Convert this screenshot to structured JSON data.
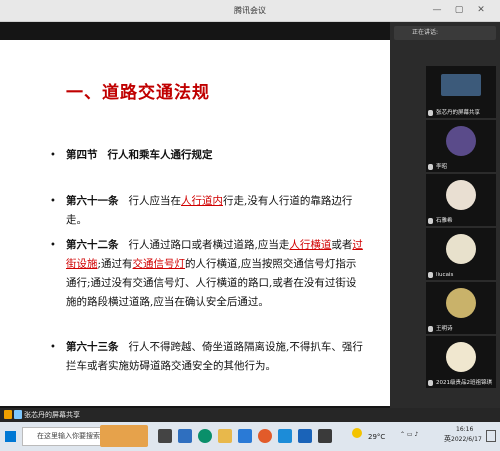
{
  "window": {
    "title": "腾讯会议"
  },
  "slide": {
    "title": "一、道路交通法规",
    "section": {
      "label": "第四节",
      "text": "行人和乘车人通行规定"
    },
    "articles": [
      {
        "num": "第六十一条",
        "text_a": "行人应当在",
        "red_a": "人行道内",
        "text_b": "行走,没有人行道的靠路边行走。"
      },
      {
        "num": "第六十二条",
        "text_a": "行人通过路口或者横过道路,应当走",
        "red_a": "人行横道",
        "text_b": "或者",
        "red_b": "过街设施",
        "text_c": ";通过有",
        "red_c": "交通信号灯",
        "text_d": "的人行横道,应当按照交通信号灯指示通行;通过没有交通信号灯、人行横道的路口,或者在没有过街设施的路段横过道路,应当在确认安全后通过。"
      },
      {
        "num": "第六十三条",
        "text_a": "行人不得跨越、倚坐道路隔离设施,不得扒车、强行拦车或者实施妨碍道路交通安全的其他行为。"
      }
    ]
  },
  "sidebar": {
    "speaking_label": "正在讲话:",
    "participants": [
      {
        "name": "张芯丹的屏幕共享"
      },
      {
        "name": "李昭"
      },
      {
        "name": "石雅希"
      },
      {
        "name": "liucais"
      },
      {
        "name": "王明诗"
      },
      {
        "name": "2021级贵品2班祖锦琪"
      }
    ]
  },
  "sharebar": {
    "text": "张芯丹的屏幕共享"
  },
  "taskbar": {
    "search_placeholder": "在这里输入你要搜索的内容",
    "weather": "29°C",
    "time": "16:16",
    "date": "2022/6/17",
    "lang": "英"
  },
  "colors": {
    "accent": "#c00000",
    "bg": "#1f1f1f"
  }
}
